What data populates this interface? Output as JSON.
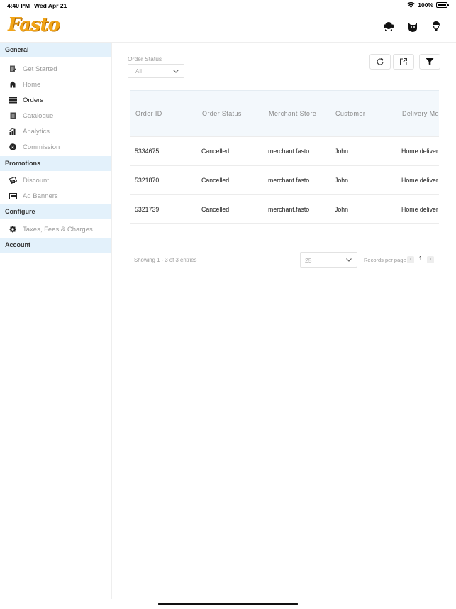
{
  "status_bar": {
    "time": "4:40 PM",
    "date": "Wed Apr 21",
    "battery": "100%"
  },
  "header": {
    "logo_text": "Fasto",
    "icons": [
      "support-agent-icon",
      "cat-face-icon",
      "user-avatar-icon"
    ]
  },
  "sidebar": {
    "sections": [
      {
        "title": "General",
        "items": [
          {
            "label": "Get Started",
            "icon": "checklist-icon"
          },
          {
            "label": "Home",
            "icon": "home-icon"
          },
          {
            "label": "Orders",
            "icon": "orders-icon"
          },
          {
            "label": "Catalogue",
            "icon": "book-icon"
          },
          {
            "label": "Analytics",
            "icon": "bar-chart-icon"
          },
          {
            "label": "Commission",
            "icon": "percent-icon"
          }
        ]
      },
      {
        "title": "Promotions",
        "items": [
          {
            "label": "Discount",
            "icon": "discount-icon"
          },
          {
            "label": "Ad Banners",
            "icon": "banner-icon"
          }
        ]
      },
      {
        "title": "Configure",
        "items": [
          {
            "label": "Taxes, Fees & Charges",
            "icon": "gear-icon"
          }
        ]
      },
      {
        "title": "Account",
        "items": []
      }
    ]
  },
  "filter": {
    "label": "Order Status",
    "value": "All"
  },
  "toolbar": {
    "icons": [
      "refresh-icon",
      "export-icon",
      "filter-icon"
    ]
  },
  "table": {
    "columns": [
      "Order ID",
      "Order Status",
      "Merchant Store",
      "Customer",
      "Delivery Mo"
    ],
    "rows": [
      [
        "5334675",
        "Cancelled",
        "merchant.fasto",
        "John",
        "Home deliver"
      ],
      [
        "5321870",
        "Cancelled",
        "merchant.fasto",
        "John",
        "Home deliver"
      ],
      [
        "5321739",
        "Cancelled",
        "merchant.fasto",
        "John",
        "Home deliver"
      ]
    ]
  },
  "pagination": {
    "info": "Showing 1 - 3 of 3 entries",
    "page_size": "25",
    "records_label": "Records per page",
    "prev": "‹",
    "current_page": "1",
    "next": "›"
  },
  "colors": {
    "section_bg": "#e3f1fb",
    "table_head_bg": "#f3f8fc",
    "logo": "#f1a417"
  }
}
